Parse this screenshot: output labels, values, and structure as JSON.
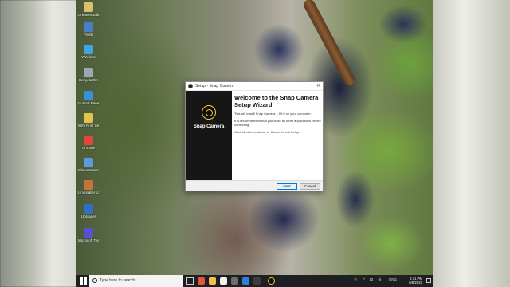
{
  "desktop": {
    "icons": [
      {
        "label": "Creators Edition"
      },
      {
        "label": "Frosty"
      },
      {
        "label": "Wireless"
      },
      {
        "label": "Recycle Bin"
      },
      {
        "label": "Control Panel"
      },
      {
        "label": "WiFi Print Services"
      },
      {
        "label": "Chrome"
      },
      {
        "label": "FilmoraMeister Tutorials"
      },
      {
        "label": "Uninstaller Utility"
      },
      {
        "label": "Uploader"
      },
      {
        "label": "Microsoft Teams"
      }
    ]
  },
  "dialog": {
    "window_title": "Setup - Snap Camera",
    "brand": "Snap Camera",
    "heading": "Welcome to the Snap Camera Setup Wizard",
    "line1": "This will install Snap Camera 1.19.0 on your computer.",
    "line2": "It is recommended that you close all other applications before continuing.",
    "line3": "Click Next to continue, or Cancel to exit Setup.",
    "next_label": "Next",
    "cancel_label": "Cancel",
    "close_glyph": "✕",
    "brand_color": "#f2d338"
  },
  "taskbar": {
    "search_placeholder": "Type here to search",
    "tray_lang": "ENG",
    "time": "2:41 PM",
    "date": "6/8/2022"
  }
}
